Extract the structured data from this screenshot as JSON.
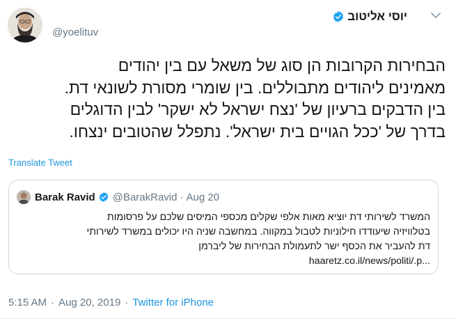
{
  "author": {
    "name": "יוסי אליטוב",
    "handle": "@yoelituv"
  },
  "body": {
    "lines": [
      "הבחירות הקרובות הן סוג של משאל עם בין יהודים",
      "מאמינים ליהודים מתבוללים. בין שומרי מסורת לשונאי דת.",
      "בין הדבקים ברעיון של 'נצח ישראל לא ישקר' לבין הדוגלים",
      "בדרך של 'ככל הגויים בית ישראל'. נתפלל שהטובים ינצחו."
    ]
  },
  "translate_label": "Translate Tweet",
  "quote": {
    "name": "Barak Ravid",
    "handle": "@BarakRavid",
    "dot": "·",
    "date": "Aug 20",
    "lines": [
      "המשרד לשירותי דת יוציא מאות אלפי שקלים מכספי המיסים שלכם על פרסומות",
      "בטלוויזיה שיעודדו חילוניות לטבול במקווה. במחשבה שניה היו יכולים במשרד לשירותי",
      "דת להעביר את הכסף ישר לתעמולת הבחירות של ליברמן"
    ],
    "link": "haaretz.co.il/news/politi/.p..."
  },
  "footer": {
    "time": "5:15 AM",
    "sep": "·",
    "date": "Aug 20, 2019",
    "sep2": "·",
    "source": "Twitter for iPhone"
  },
  "colors": {
    "link_blue": "#1b95e0",
    "verified_blue": "#1da1f2",
    "secondary_text": "#657786",
    "border": "#ccd6dd"
  }
}
